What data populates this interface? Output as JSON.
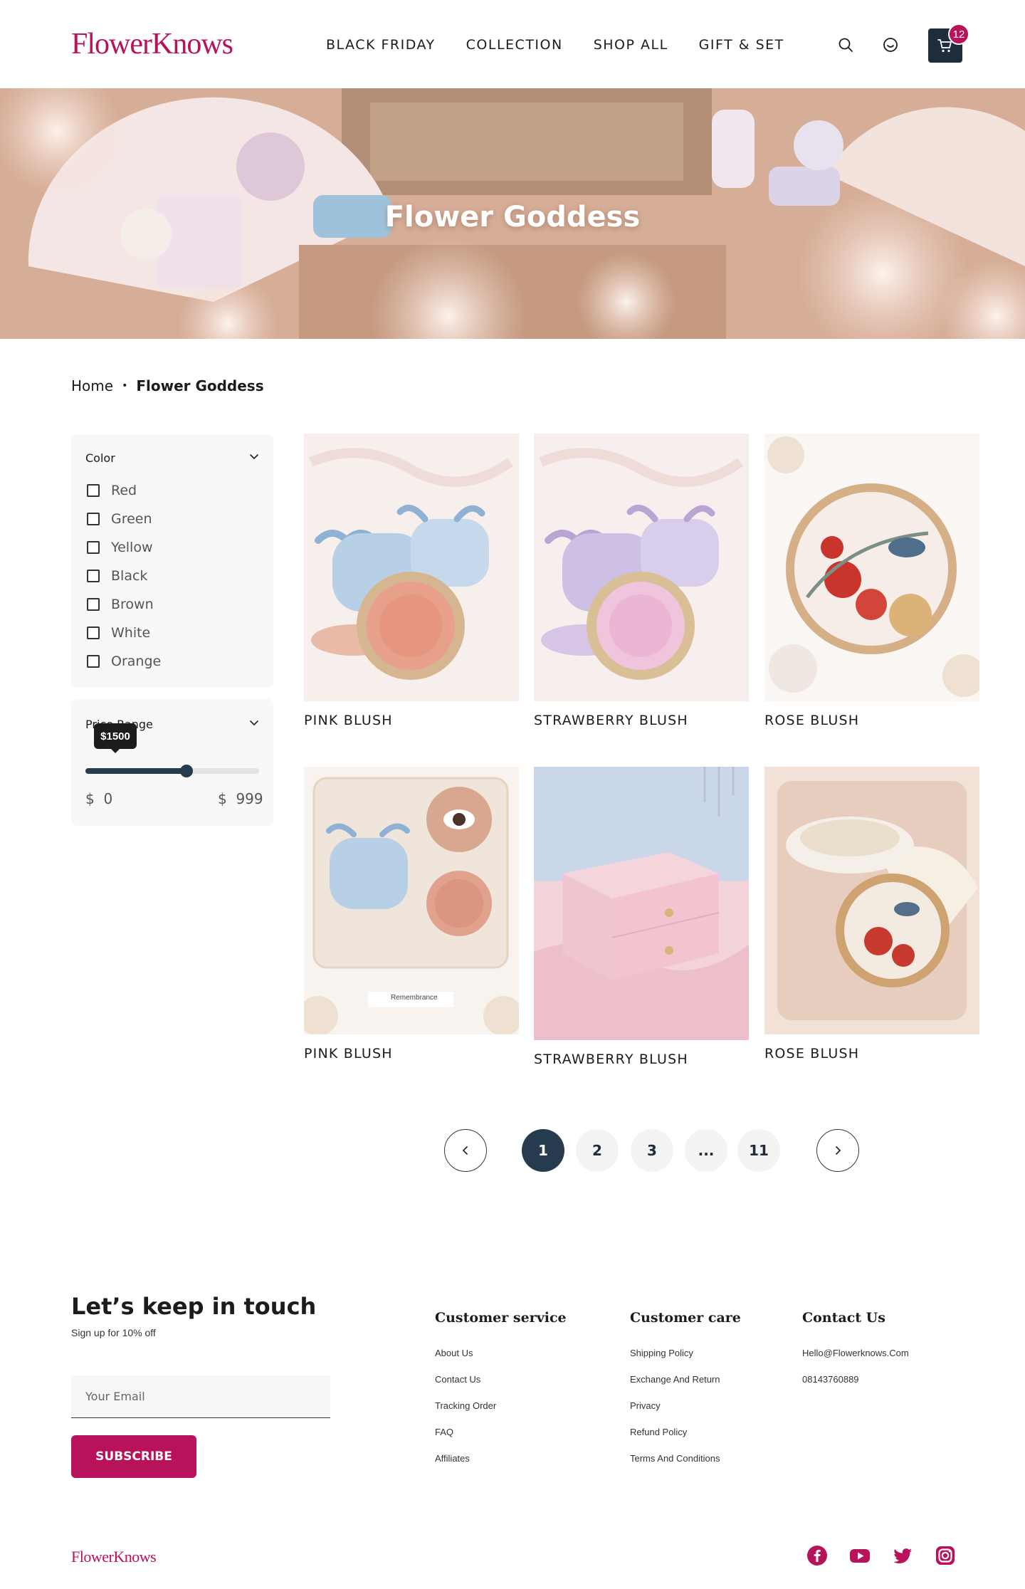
{
  "brand": {
    "logo": "FlowerKnows",
    "color": "#b8125a"
  },
  "nav": [
    "BLACK FRIDAY",
    "COLLECTION",
    "SHOP ALL",
    "GIFT & SET"
  ],
  "header_icons": [
    "search-icon",
    "user-icon",
    "cart-icon"
  ],
  "cart": {
    "count": "12"
  },
  "hero": {
    "title": "Flower Goddess"
  },
  "breadcrumb": {
    "home": "Home",
    "current": "Flower Goddess"
  },
  "filters": {
    "color": {
      "title": "Color",
      "options": [
        "Red",
        "Green",
        "Yellow",
        "Black",
        "Brown",
        "White",
        "Orange"
      ]
    },
    "price": {
      "title": "Price Range",
      "tooltip": "$1500",
      "fill_fraction": 0.58,
      "min_currency": "$",
      "min": "0",
      "max_currency": "$",
      "max": "999"
    }
  },
  "products": [
    {
      "name": "PINK BLUSH",
      "image": "blue-blush-compact"
    },
    {
      "name": "STRAWBERRY BLUSH",
      "image": "lilac-blush-compact"
    },
    {
      "name": "ROSE BLUSH",
      "image": "rose-mirror-compact"
    },
    {
      "name": "PINK BLUSH",
      "image": "blush-with-eye-closeup"
    },
    {
      "name": "STRAWBERRY BLUSH",
      "image": "pink-jewelry-box"
    },
    {
      "name": "ROSE BLUSH",
      "image": "rose-cushion-compact"
    }
  ],
  "product_image_caption": "Remembrance",
  "pagination": {
    "pages": [
      "1",
      "2",
      "3",
      "...",
      "11"
    ],
    "current": "1"
  },
  "footer": {
    "title": "Let’s keep in touch",
    "subtitle": "Sign up for 10% off",
    "email_placeholder": "Your Email",
    "subscribe": "SUBSCRIBE",
    "columns": [
      {
        "title": "Customer service",
        "links": [
          "About Us",
          "Contact Us",
          "Tracking Order",
          "FAQ",
          "Affiliates"
        ]
      },
      {
        "title": "Customer care",
        "links": [
          "Shipping Policy",
          "Exchange And Return",
          "Privacy",
          "Refund Policy",
          "Terms And Conditions"
        ]
      },
      {
        "title": "Contact Us",
        "links": [
          "Hello@Flowerknows.Com",
          "08143760889"
        ]
      }
    ],
    "logo": "FlowerKnows",
    "social": [
      "facebook-icon",
      "youtube-icon",
      "twitter-icon",
      "instagram-icon"
    ]
  },
  "colors": {
    "accent": "#b8125a",
    "navy": "#263b4e",
    "panel": "#f8f8f8"
  }
}
